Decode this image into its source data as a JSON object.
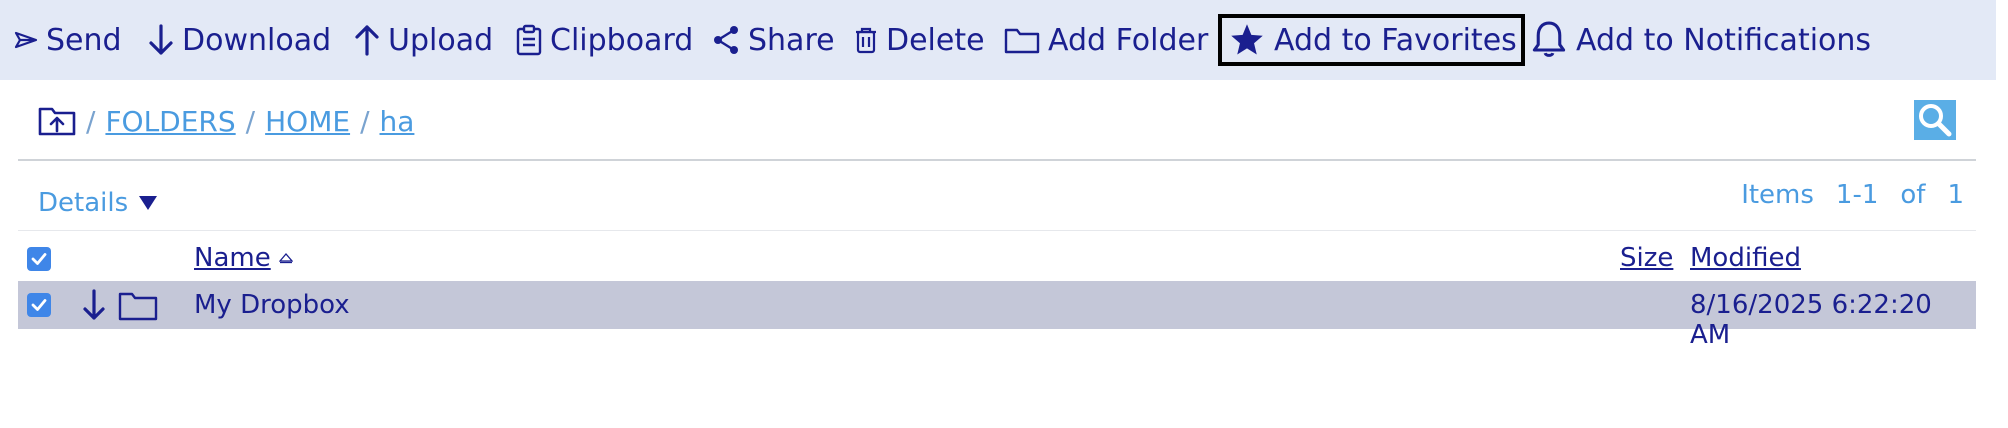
{
  "toolbar": {
    "send": "Send",
    "download": "Download",
    "upload": "Upload",
    "clipboard": "Clipboard",
    "share": "Share",
    "delete": "Delete",
    "add_folder": "Add Folder",
    "add_favorites": "Add to Favorites",
    "add_notifications": "Add to Notifications"
  },
  "breadcrumb": {
    "sep": "/",
    "items": [
      "FOLDERS",
      "HOME",
      "ha"
    ]
  },
  "view": {
    "details_label": "Details"
  },
  "pagination": {
    "items_label": "Items",
    "range": "1-1",
    "of_label": "of",
    "total": "1"
  },
  "table": {
    "columns": {
      "name": "Name",
      "size": "Size",
      "modified": "Modified"
    },
    "rows": [
      {
        "name": "My Dropbox",
        "size": "",
        "modified": "8/16/2025 6:22:20 AM",
        "checked": true
      }
    ]
  },
  "colors": {
    "accent": "#1a1f8f",
    "link": "#4a9be0",
    "toolbar_bg": "#e3e9f6",
    "row_selected": "#c4c7d8",
    "checkbox": "#3f86e8"
  },
  "icons": [
    "send-icon",
    "download-icon",
    "upload-icon",
    "clipboard-icon",
    "share-icon",
    "trash-icon",
    "folder-icon",
    "star-icon",
    "bell-icon",
    "folder-up-icon",
    "search-icon",
    "dropdown-triangle-icon",
    "sort-asc-icon",
    "checkbox-icon"
  ]
}
